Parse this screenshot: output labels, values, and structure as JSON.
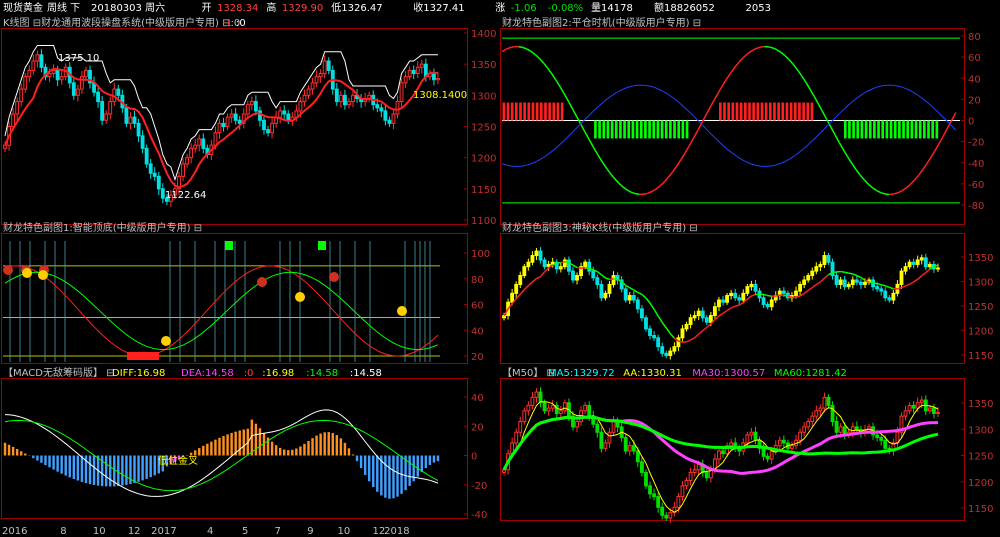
{
  "topbar": {
    "items": [
      {
        "text": "现货黄金",
        "color": "#ffffff"
      },
      {
        "text": "周线 下",
        "color": "#ffffff"
      },
      {
        "text": "20180303 周六",
        "color": "#ffffff"
      },
      {
        "text": "开",
        "color": "#ffffff"
      },
      {
        "text": "1328.34",
        "color": "#ff4040"
      },
      {
        "text": "高",
        "color": "#ffffff"
      },
      {
        "text": "1329.90",
        "color": "#ff4040"
      },
      {
        "text": "低1326.47",
        "color": "#ffffff"
      },
      {
        "text": "收1327.41",
        "color": "#ffffff"
      },
      {
        "text": "涨",
        "color": "#ffffff"
      },
      {
        "text": "-1.06",
        "color": "#00e000"
      },
      {
        "text": "-0.08%",
        "color": "#00e000"
      },
      {
        "text": "量14178",
        "color": "#ffffff"
      },
      {
        "text": "额18826052",
        "color": "#ffffff"
      },
      {
        "text": "2053",
        "color": "#ffffff"
      }
    ]
  },
  "panels": {
    "kline": {
      "title": "K线图 ⊟财龙通用波段操盘系统(中级版用户专用) ⊟:0",
      "extra1": ":1",
      "extra2": ":0",
      "axis": [
        "1400",
        "1350",
        "1300",
        "1250",
        "1200",
        "1150",
        "1100"
      ],
      "labels": {
        "high": "1375.10",
        "low": "1122.64",
        "last": "1308.1400"
      }
    },
    "pcsj": {
      "title": "财龙特色副图2:平仓时机(中级版用户专用) ⊟",
      "axis": [
        "80",
        "60",
        "40",
        "20",
        "0",
        "-20",
        "-40",
        "-60",
        "-80"
      ]
    },
    "znding": {
      "title": "财龙特色副图1:智能顶底(中级版用户专用) ⊟",
      "axis": [
        "100",
        "80",
        "60",
        "40",
        "20"
      ]
    },
    "smk": {
      "title": "财龙特色副图3:神秘K线(中级版用户专用) ⊟",
      "axis": [
        "1350",
        "1300",
        "1250",
        "1200",
        "1150"
      ]
    },
    "macd": {
      "title_prefix": "【MACD无敌筹码版】 ⊟",
      "legend": [
        {
          "text": "DIFF:16.98",
          "color": "#ffff00"
        },
        {
          "text": "DEA:14.58",
          "color": "#ff40ff"
        },
        {
          "text": ":0",
          "color": "#ff4040"
        },
        {
          "text": ":16.98",
          "color": "#ffff00"
        },
        {
          "text": ":14.58",
          "color": "#00ff00"
        },
        {
          "text": ":14.58",
          "color": "#ffffff"
        }
      ],
      "axis": [
        "40",
        "20",
        "0",
        "-20",
        "-40"
      ],
      "annotation": "低位金叉"
    },
    "m50": {
      "title_prefix": "【M50】 ⊟",
      "legend": [
        {
          "text": "MA5:1329.72",
          "color": "#00ffff"
        },
        {
          "text": "AA:1330.31",
          "color": "#ffff00"
        },
        {
          "text": "MA30:1300.57",
          "color": "#ff40ff"
        },
        {
          "text": "MA60:1281.42",
          "color": "#00ff00"
        }
      ],
      "axis": [
        "1350",
        "1300",
        "1250",
        "1200",
        "1150"
      ]
    }
  },
  "date_axis": [
    {
      "text": "2016",
      "x": 0.0
    },
    {
      "text": "8",
      "x": 0.125
    },
    {
      "text": "10",
      "x": 0.195
    },
    {
      "text": "12",
      "x": 0.27
    },
    {
      "text": "2017",
      "x": 0.32
    },
    {
      "text": "4",
      "x": 0.44
    },
    {
      "text": "5",
      "x": 0.515
    },
    {
      "text": "7",
      "x": 0.585
    },
    {
      "text": "9",
      "x": 0.655
    },
    {
      "text": "10",
      "x": 0.72
    },
    {
      "text": "12",
      "x": 0.795
    },
    {
      "text": "2018",
      "x": 0.82
    }
  ],
  "chart_data": {
    "type": "candlestick",
    "description_series": "weekly gold price, approximate",
    "ylim": [
      1100,
      1400
    ],
    "closes": [
      1220,
      1250,
      1270,
      1290,
      1310,
      1330,
      1340,
      1355,
      1365,
      1345,
      1330,
      1335,
      1340,
      1325,
      1330,
      1345,
      1320,
      1300,
      1310,
      1330,
      1340,
      1320,
      1305,
      1290,
      1260,
      1270,
      1290,
      1310,
      1300,
      1280,
      1255,
      1265,
      1255,
      1235,
      1215,
      1190,
      1175,
      1170,
      1150,
      1135,
      1130,
      1140,
      1150,
      1170,
      1190,
      1200,
      1215,
      1220,
      1230,
      1215,
      1205,
      1220,
      1240,
      1255,
      1250,
      1265,
      1270,
      1260,
      1255,
      1270,
      1285,
      1290,
      1275,
      1260,
      1245,
      1240,
      1255,
      1265,
      1275,
      1270,
      1260,
      1265,
      1275,
      1290,
      1300,
      1310,
      1320,
      1330,
      1335,
      1355,
      1340,
      1310,
      1290,
      1300,
      1285,
      1290,
      1300,
      1295,
      1290,
      1295,
      1300,
      1285,
      1280,
      1275,
      1260,
      1255,
      1270,
      1290,
      1320,
      1330,
      1340,
      1335,
      1345,
      1350,
      1330,
      1335,
      1325,
      1327
    ]
  }
}
